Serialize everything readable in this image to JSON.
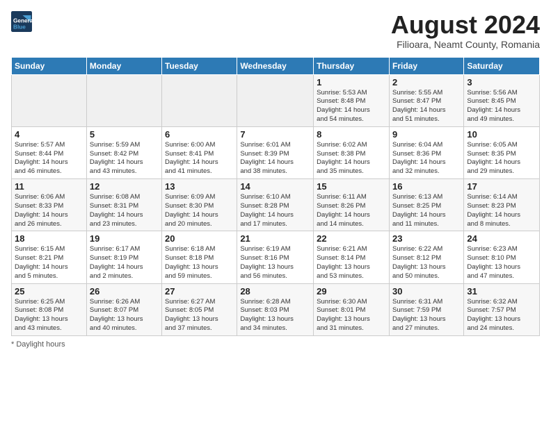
{
  "header": {
    "logo_line1": "General",
    "logo_line2": "Blue",
    "month_year": "August 2024",
    "location": "Filioara, Neamt County, Romania"
  },
  "footer": {
    "note": "Daylight hours"
  },
  "days_of_week": [
    "Sunday",
    "Monday",
    "Tuesday",
    "Wednesday",
    "Thursday",
    "Friday",
    "Saturday"
  ],
  "weeks": [
    [
      {
        "day": "",
        "info": ""
      },
      {
        "day": "",
        "info": ""
      },
      {
        "day": "",
        "info": ""
      },
      {
        "day": "",
        "info": ""
      },
      {
        "day": "1",
        "info": "Sunrise: 5:53 AM\nSunset: 8:48 PM\nDaylight: 14 hours\nand 54 minutes."
      },
      {
        "day": "2",
        "info": "Sunrise: 5:55 AM\nSunset: 8:47 PM\nDaylight: 14 hours\nand 51 minutes."
      },
      {
        "day": "3",
        "info": "Sunrise: 5:56 AM\nSunset: 8:45 PM\nDaylight: 14 hours\nand 49 minutes."
      }
    ],
    [
      {
        "day": "4",
        "info": "Sunrise: 5:57 AM\nSunset: 8:44 PM\nDaylight: 14 hours\nand 46 minutes."
      },
      {
        "day": "5",
        "info": "Sunrise: 5:59 AM\nSunset: 8:42 PM\nDaylight: 14 hours\nand 43 minutes."
      },
      {
        "day": "6",
        "info": "Sunrise: 6:00 AM\nSunset: 8:41 PM\nDaylight: 14 hours\nand 41 minutes."
      },
      {
        "day": "7",
        "info": "Sunrise: 6:01 AM\nSunset: 8:39 PM\nDaylight: 14 hours\nand 38 minutes."
      },
      {
        "day": "8",
        "info": "Sunrise: 6:02 AM\nSunset: 8:38 PM\nDaylight: 14 hours\nand 35 minutes."
      },
      {
        "day": "9",
        "info": "Sunrise: 6:04 AM\nSunset: 8:36 PM\nDaylight: 14 hours\nand 32 minutes."
      },
      {
        "day": "10",
        "info": "Sunrise: 6:05 AM\nSunset: 8:35 PM\nDaylight: 14 hours\nand 29 minutes."
      }
    ],
    [
      {
        "day": "11",
        "info": "Sunrise: 6:06 AM\nSunset: 8:33 PM\nDaylight: 14 hours\nand 26 minutes."
      },
      {
        "day": "12",
        "info": "Sunrise: 6:08 AM\nSunset: 8:31 PM\nDaylight: 14 hours\nand 23 minutes."
      },
      {
        "day": "13",
        "info": "Sunrise: 6:09 AM\nSunset: 8:30 PM\nDaylight: 14 hours\nand 20 minutes."
      },
      {
        "day": "14",
        "info": "Sunrise: 6:10 AM\nSunset: 8:28 PM\nDaylight: 14 hours\nand 17 minutes."
      },
      {
        "day": "15",
        "info": "Sunrise: 6:11 AM\nSunset: 8:26 PM\nDaylight: 14 hours\nand 14 minutes."
      },
      {
        "day": "16",
        "info": "Sunrise: 6:13 AM\nSunset: 8:25 PM\nDaylight: 14 hours\nand 11 minutes."
      },
      {
        "day": "17",
        "info": "Sunrise: 6:14 AM\nSunset: 8:23 PM\nDaylight: 14 hours\nand 8 minutes."
      }
    ],
    [
      {
        "day": "18",
        "info": "Sunrise: 6:15 AM\nSunset: 8:21 PM\nDaylight: 14 hours\nand 5 minutes."
      },
      {
        "day": "19",
        "info": "Sunrise: 6:17 AM\nSunset: 8:19 PM\nDaylight: 14 hours\nand 2 minutes."
      },
      {
        "day": "20",
        "info": "Sunrise: 6:18 AM\nSunset: 8:18 PM\nDaylight: 13 hours\nand 59 minutes."
      },
      {
        "day": "21",
        "info": "Sunrise: 6:19 AM\nSunset: 8:16 PM\nDaylight: 13 hours\nand 56 minutes."
      },
      {
        "day": "22",
        "info": "Sunrise: 6:21 AM\nSunset: 8:14 PM\nDaylight: 13 hours\nand 53 minutes."
      },
      {
        "day": "23",
        "info": "Sunrise: 6:22 AM\nSunset: 8:12 PM\nDaylight: 13 hours\nand 50 minutes."
      },
      {
        "day": "24",
        "info": "Sunrise: 6:23 AM\nSunset: 8:10 PM\nDaylight: 13 hours\nand 47 minutes."
      }
    ],
    [
      {
        "day": "25",
        "info": "Sunrise: 6:25 AM\nSunset: 8:08 PM\nDaylight: 13 hours\nand 43 minutes."
      },
      {
        "day": "26",
        "info": "Sunrise: 6:26 AM\nSunset: 8:07 PM\nDaylight: 13 hours\nand 40 minutes."
      },
      {
        "day": "27",
        "info": "Sunrise: 6:27 AM\nSunset: 8:05 PM\nDaylight: 13 hours\nand 37 minutes."
      },
      {
        "day": "28",
        "info": "Sunrise: 6:28 AM\nSunset: 8:03 PM\nDaylight: 13 hours\nand 34 minutes."
      },
      {
        "day": "29",
        "info": "Sunrise: 6:30 AM\nSunset: 8:01 PM\nDaylight: 13 hours\nand 31 minutes."
      },
      {
        "day": "30",
        "info": "Sunrise: 6:31 AM\nSunset: 7:59 PM\nDaylight: 13 hours\nand 27 minutes."
      },
      {
        "day": "31",
        "info": "Sunrise: 6:32 AM\nSunset: 7:57 PM\nDaylight: 13 hours\nand 24 minutes."
      }
    ]
  ]
}
